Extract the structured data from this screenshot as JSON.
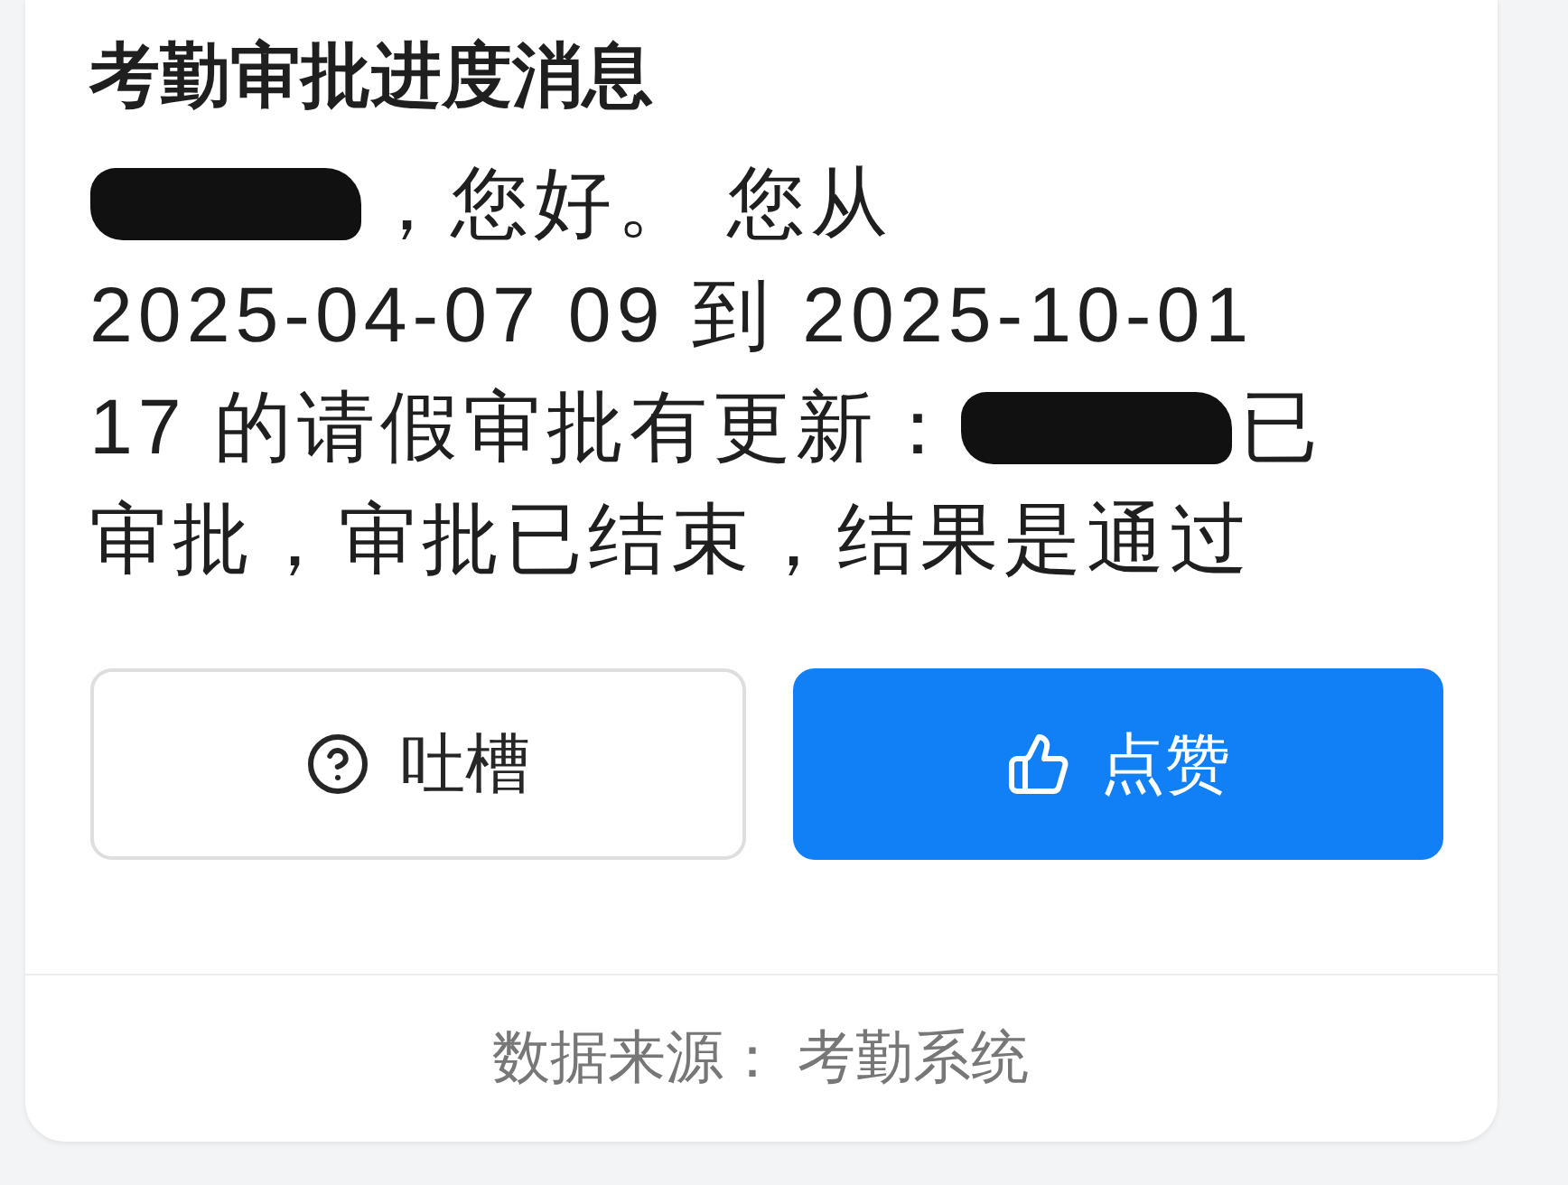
{
  "card": {
    "title": "考勤审批进度消息",
    "message_lines": [
      [
        {
          "kind": "redaction"
        },
        {
          "kind": "text",
          "text": "，您好。 您从"
        }
      ],
      [
        {
          "kind": "text",
          "text": "2025-04-07 09 到 2025-10-01"
        }
      ],
      [
        {
          "kind": "text",
          "text": "17 的请假审批有更新："
        },
        {
          "kind": "redaction"
        },
        {
          "kind": "text",
          "text": "已"
        }
      ],
      [
        {
          "kind": "text",
          "text": "审批，审批已结束，结果是通过"
        }
      ]
    ],
    "buttons": [
      {
        "label": "吐槽",
        "kind": "complain"
      },
      {
        "label": "点赞",
        "kind": "like"
      }
    ],
    "footer": "数据来源： 考勤系统"
  }
}
